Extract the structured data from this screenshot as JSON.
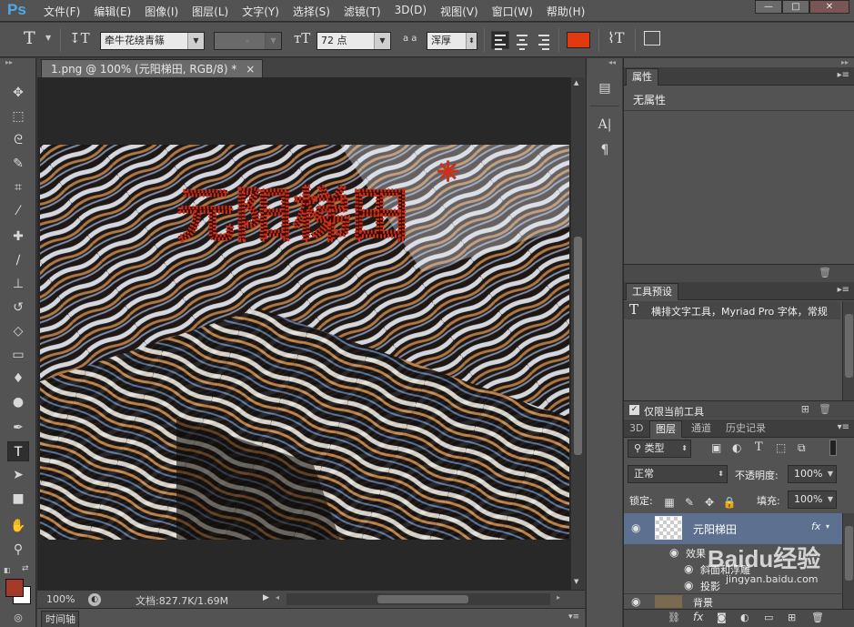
{
  "app": {
    "logo": "Ps",
    "menu": [
      "文件(F)",
      "编辑(E)",
      "图像(I)",
      "图层(L)",
      "文字(Y)",
      "选择(S)",
      "滤镜(T)",
      "3D(D)",
      "视图(V)",
      "窗口(W)",
      "帮助(H)"
    ]
  },
  "options_bar": {
    "tool_glyph": "T",
    "font_family": "牵牛花绕青篠",
    "font_style": "-",
    "font_size": "72 点",
    "aa_label": "a a",
    "antialias": "浑厚",
    "text_color": "#e23a10"
  },
  "document": {
    "tab_title": "1.png @ 100% (元阳梯田, RGB/8) *",
    "tab_close": "×",
    "canvas_text": "元阳梯田",
    "zoom": "100%",
    "doc_info": "文档:827.7K/1.69M",
    "timeline": "时间轴"
  },
  "properties_panel": {
    "tab": "属性",
    "content": "无属性"
  },
  "tool_presets_panel": {
    "tab": "工具预设",
    "item_text": "横排文字工具，Myriad Pro 字体，常规",
    "checkbox_label": "仅限当前工具"
  },
  "layers_panel": {
    "tabs": [
      "3D",
      "图层",
      "通道",
      "历史记录"
    ],
    "filter_kind": "类型",
    "blend_mode": "正常",
    "opacity_label": "不透明度:",
    "opacity_value": "100%",
    "lock_label": "锁定:",
    "fill_label": "填充:",
    "fill_value": "100%",
    "layers": [
      {
        "name": "元阳梯田",
        "fx": "fx"
      },
      {
        "name": "效果",
        "sub": true
      },
      {
        "name": "斜面和浮雕",
        "sub": true
      },
      {
        "name": "投影",
        "sub": true
      },
      {
        "name": "背景"
      }
    ]
  },
  "watermark": {
    "text": "Baidu经验",
    "url": "jingyan.baidu.com"
  },
  "colors": {
    "foreground": "#a53a28",
    "background": "#ffffff"
  }
}
